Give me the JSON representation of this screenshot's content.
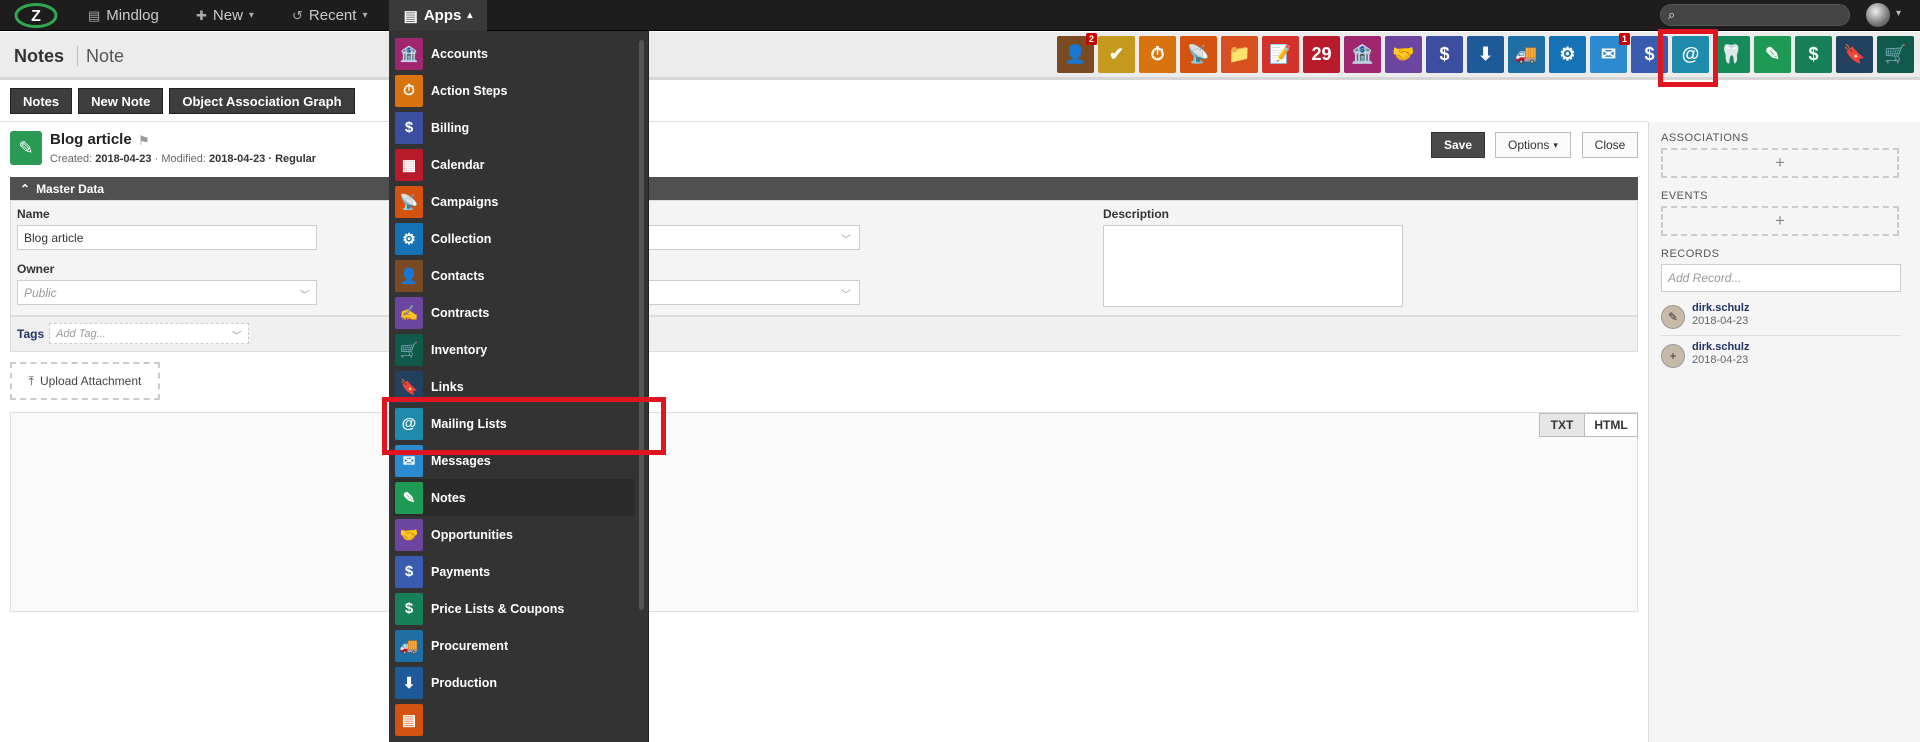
{
  "topnav": {
    "mindlog": "Mindlog",
    "new": "New",
    "recent": "Recent",
    "apps": "Apps"
  },
  "page": {
    "title": "Notes",
    "subtitle": "Note"
  },
  "app_icons": [
    {
      "name": "contacts",
      "color": "#7a4a23",
      "glyph": "👤",
      "badge": "2"
    },
    {
      "name": "action-steps",
      "color": "#c39a1d",
      "glyph": "✔",
      "badge": ""
    },
    {
      "name": "timer",
      "color": "#d9730f",
      "glyph": "⏱",
      "badge": ""
    },
    {
      "name": "campaigns",
      "color": "#d45311",
      "glyph": "📡",
      "badge": ""
    },
    {
      "name": "collection",
      "color": "#d8501f",
      "glyph": "📁",
      "badge": ""
    },
    {
      "name": "contracts",
      "color": "#d3322a",
      "glyph": "📝",
      "badge": ""
    },
    {
      "name": "calendar",
      "color": "#b81c2c",
      "glyph": "29",
      "badge": ""
    },
    {
      "name": "accounts",
      "color": "#a0266f",
      "glyph": "🏦",
      "badge": ""
    },
    {
      "name": "opportunities",
      "color": "#6c45a0",
      "glyph": "🤝",
      "badge": ""
    },
    {
      "name": "billing",
      "color": "#3b4ea0",
      "glyph": "$",
      "badge": ""
    },
    {
      "name": "production",
      "color": "#1f5a98",
      "glyph": "⬇",
      "badge": ""
    },
    {
      "name": "procurement",
      "color": "#1f6fa5",
      "glyph": "🚚",
      "badge": ""
    },
    {
      "name": "collection-2",
      "color": "#1573b5",
      "glyph": "⚙",
      "badge": ""
    },
    {
      "name": "messages",
      "color": "#2c8ad0",
      "glyph": "✉",
      "badge": "1"
    },
    {
      "name": "payments",
      "color": "#3a5cb0",
      "glyph": "$",
      "badge": ""
    },
    {
      "name": "mailing-lists",
      "color": "#1e8bac",
      "glyph": "@",
      "badge": ""
    },
    {
      "name": "dental",
      "color": "#178a5a",
      "glyph": "🦷",
      "badge": ""
    },
    {
      "name": "notes",
      "color": "#1f9a55",
      "glyph": "✎",
      "badge": ""
    },
    {
      "name": "price-lists",
      "color": "#178058",
      "glyph": "$",
      "badge": ""
    },
    {
      "name": "links",
      "color": "#22415e",
      "glyph": "🔖",
      "badge": ""
    },
    {
      "name": "inventory",
      "color": "#0f5a4a",
      "glyph": "🛒",
      "badge": ""
    }
  ],
  "buttons": {
    "notes": "Notes",
    "new_note": "New Note",
    "object_graph": "Object Association Graph",
    "save": "Save",
    "options": "Options",
    "close": "Close",
    "upload": "Upload Attachment",
    "txt": "TXT",
    "html": "HTML"
  },
  "record": {
    "title": "Blog article",
    "created_label": "Created:",
    "created": "2018-04-23",
    "modified_label": "· Modified:",
    "modified": "2018-04-23",
    "type": "· Regular"
  },
  "form": {
    "section": "Master Data",
    "name_label": "Name",
    "name_value": "Blog article",
    "owner_label": "Owner",
    "owner_placeholder": "Public",
    "description_label": "Description",
    "tags_label": "Tags",
    "tags_placeholder": "Add Tag..."
  },
  "sidebar": {
    "associations": "ASSOCIATIONS",
    "events": "EVENTS",
    "records": "RECORDS",
    "add_record": "Add Record...",
    "entries": [
      {
        "user": "dirk.schulz",
        "date": "2018-04-23",
        "glyph": "✎"
      },
      {
        "user": "dirk.schulz",
        "date": "2018-04-23",
        "glyph": "+"
      }
    ]
  },
  "apps_menu": [
    {
      "label": "Accounts",
      "color": "#a0266f",
      "glyph": "🏦"
    },
    {
      "label": "Action Steps",
      "color": "#d9730f",
      "glyph": "⏱"
    },
    {
      "label": "Billing",
      "color": "#3b4ea0",
      "glyph": "$"
    },
    {
      "label": "Calendar",
      "color": "#b81c2c",
      "glyph": "▦"
    },
    {
      "label": "Campaigns",
      "color": "#d45311",
      "glyph": "📡"
    },
    {
      "label": "Collection",
      "color": "#1573b5",
      "glyph": "⚙"
    },
    {
      "label": "Contacts",
      "color": "#7a4a23",
      "glyph": "👤"
    },
    {
      "label": "Contracts",
      "color": "#6c45a0",
      "glyph": "✍"
    },
    {
      "label": "Inventory",
      "color": "#0f5a4a",
      "glyph": "🛒"
    },
    {
      "label": "Links",
      "color": "#22415e",
      "glyph": "🔖"
    },
    {
      "label": "Mailing Lists",
      "color": "#1e8bac",
      "glyph": "@"
    },
    {
      "label": "Messages",
      "color": "#2c8ad0",
      "glyph": "✉"
    },
    {
      "label": "Notes",
      "color": "#1f9a55",
      "glyph": "✎"
    },
    {
      "label": "Opportunities",
      "color": "#6c45a0",
      "glyph": "🤝"
    },
    {
      "label": "Payments",
      "color": "#3a5cb0",
      "glyph": "$"
    },
    {
      "label": "Price Lists & Coupons",
      "color": "#178058",
      "glyph": "$"
    },
    {
      "label": "Procurement",
      "color": "#1f6fa5",
      "glyph": "🚚"
    },
    {
      "label": "Production",
      "color": "#1f5a98",
      "glyph": "⬇"
    },
    {
      "label": "",
      "color": "#d45311",
      "glyph": "▤"
    }
  ],
  "active_menu_item": "Notes",
  "highlight_color": "#e0151f"
}
